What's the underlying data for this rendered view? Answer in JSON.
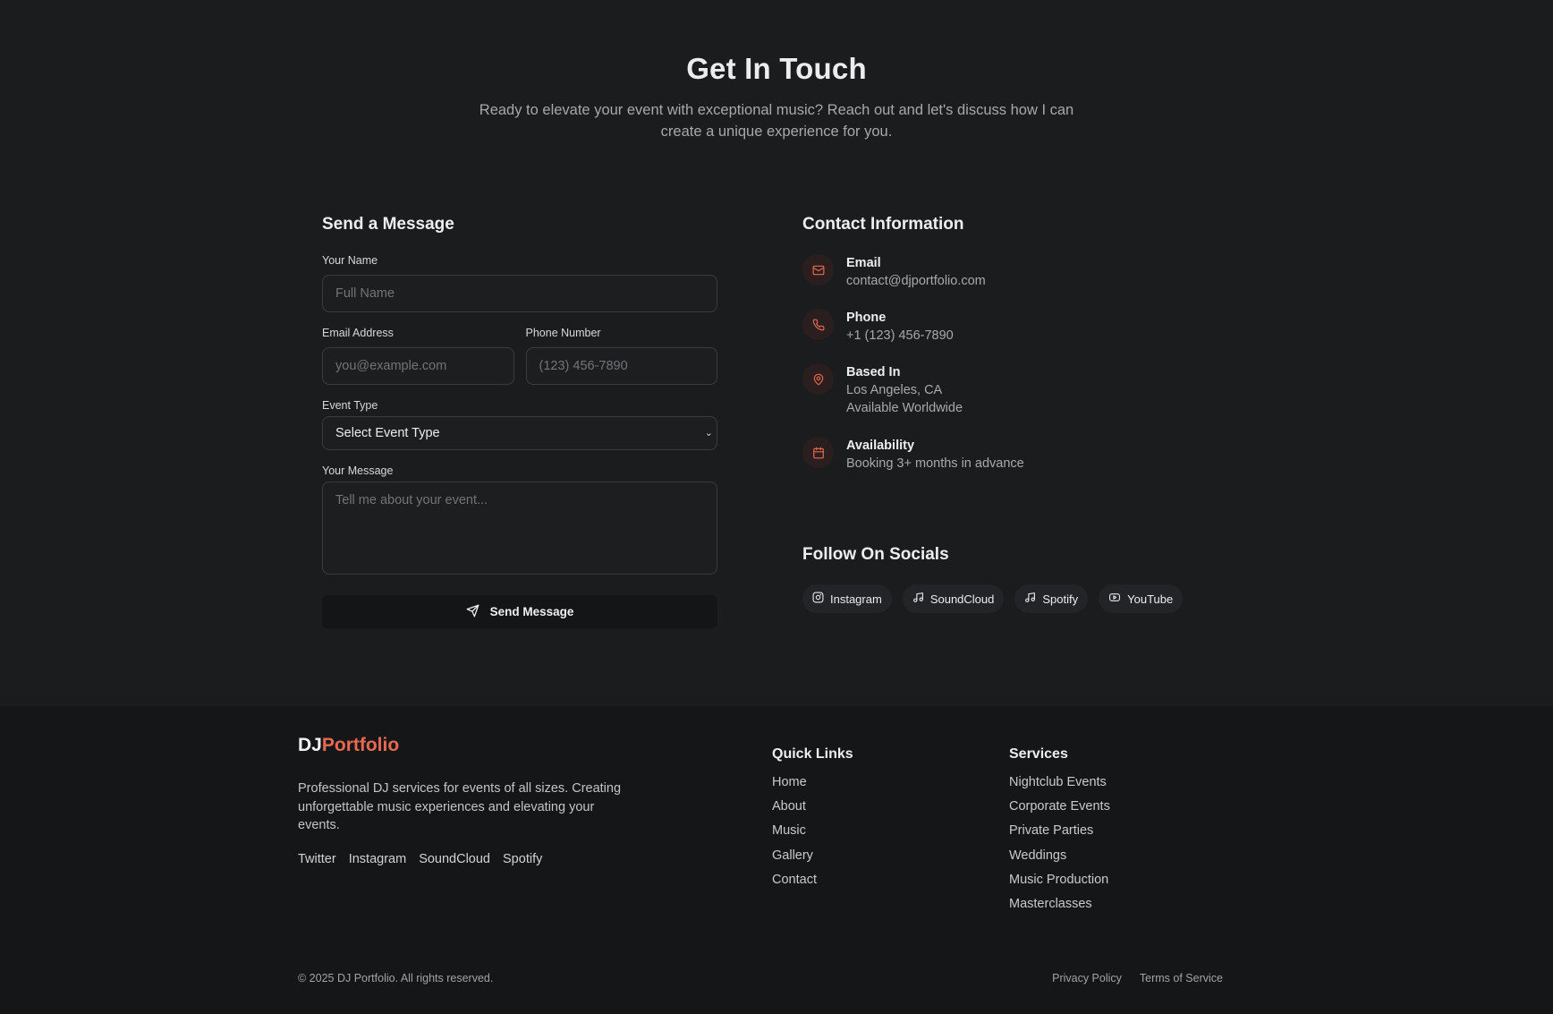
{
  "hero": {
    "title": "Get In Touch",
    "subtitle": "Ready to elevate your event with exceptional music? Reach out and let's discuss how I can create a unique experience for you."
  },
  "form": {
    "heading": "Send a Message",
    "name_label": "Your Name",
    "name_placeholder": "Full Name",
    "email_label": "Email Address",
    "email_placeholder": "you@example.com",
    "phone_label": "Phone Number",
    "phone_placeholder": "(123) 456-7890",
    "event_label": "Event Type",
    "event_selected": "Select Event Type",
    "message_label": "Your Message",
    "message_placeholder": "Tell me about your event...",
    "send_label": "Send Message"
  },
  "contact": {
    "heading": "Contact Information",
    "email_title": "Email",
    "email_value": "contact@djportfolio.com",
    "phone_title": "Phone",
    "phone_value": "+1 (123) 456-7890",
    "location_title": "Based In",
    "location_value": "Los Angeles, CA",
    "location_value2": "Available Worldwide",
    "availability_title": "Availability",
    "availability_value": "Booking 3+ months in advance"
  },
  "socials": {
    "heading": "Follow On Socials",
    "items": [
      {
        "label": "Instagram",
        "icon": "instagram-icon"
      },
      {
        "label": "SoundCloud",
        "icon": "music-note-icon"
      },
      {
        "label": "Spotify",
        "icon": "music-note-icon"
      },
      {
        "label": "YouTube",
        "icon": "youtube-icon"
      }
    ]
  },
  "footer": {
    "brand_prefix": "DJ",
    "brand_accent": "Portfolio",
    "description": "Professional DJ services for events of all sizes. Creating unforgettable music experiences and elevating your events.",
    "social_links": [
      "Twitter",
      "Instagram",
      "SoundCloud",
      "Spotify"
    ],
    "quick_links_title": "Quick Links",
    "quick_links": [
      "Home",
      "About",
      "Music",
      "Gallery",
      "Contact"
    ],
    "services_title": "Services",
    "services": [
      "Nightclub Events",
      "Corporate Events",
      "Private Parties",
      "Weddings",
      "Music Production",
      "Masterclasses"
    ],
    "copyright": "© 2025 DJ Portfolio. All rights reserved.",
    "privacy": "Privacy Policy",
    "terms": "Terms of Service"
  },
  "colors": {
    "accent": "#e8694f",
    "page_bg": "#1b1c1e",
    "footer_bg": "#151618"
  }
}
